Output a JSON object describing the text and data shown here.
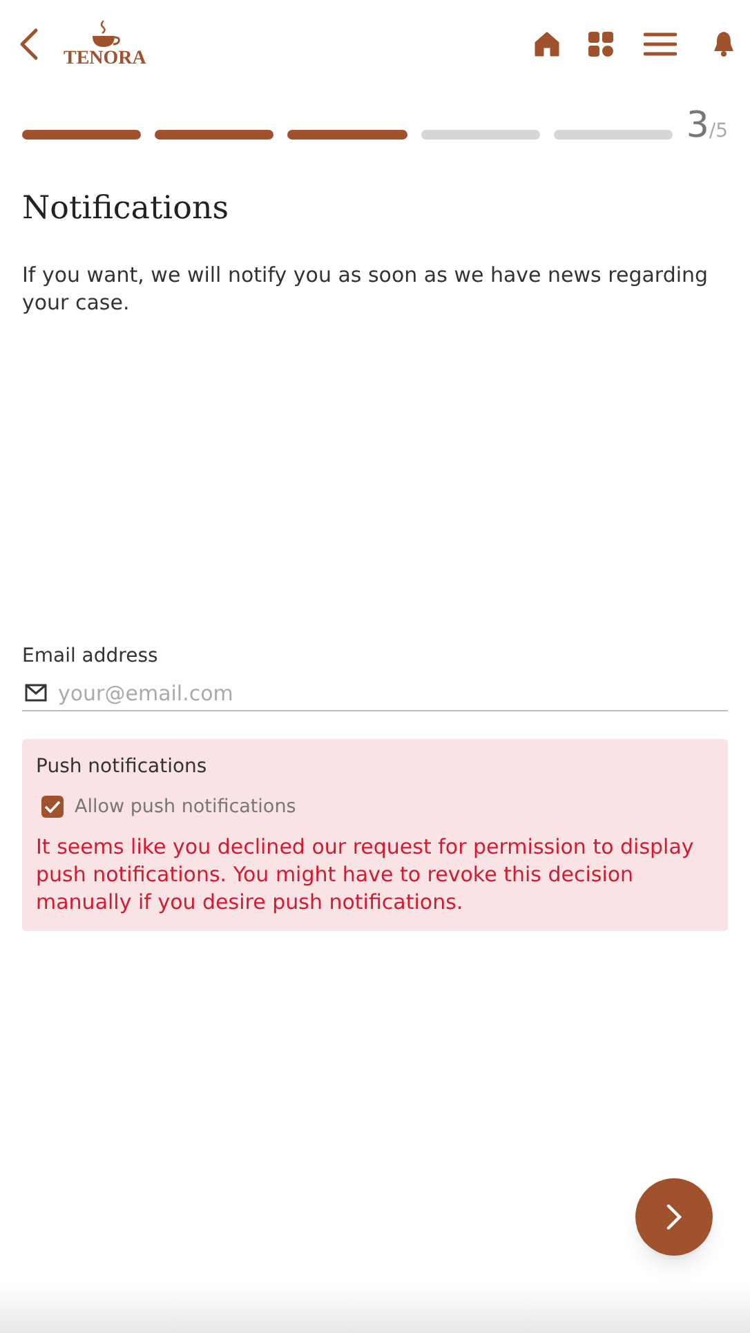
{
  "header": {
    "logo_text": "TENORA"
  },
  "progress": {
    "steps": [
      {
        "completed": true
      },
      {
        "completed": true
      },
      {
        "completed": true
      },
      {
        "completed": false
      },
      {
        "completed": false
      }
    ],
    "current": "3",
    "total": "/5"
  },
  "title": "Notifications",
  "intro": "If you want, we will notify you as soon as we have news regarding your case.",
  "email": {
    "label": "Email address",
    "placeholder": "your@email.com"
  },
  "push": {
    "title": "Push notifications",
    "checkbox_label": "Allow push notifications",
    "checked": true,
    "warning": "It seems like you declined our request for permission to display push notifications. You might have to revoke this decision manually if you desire push notifications."
  }
}
